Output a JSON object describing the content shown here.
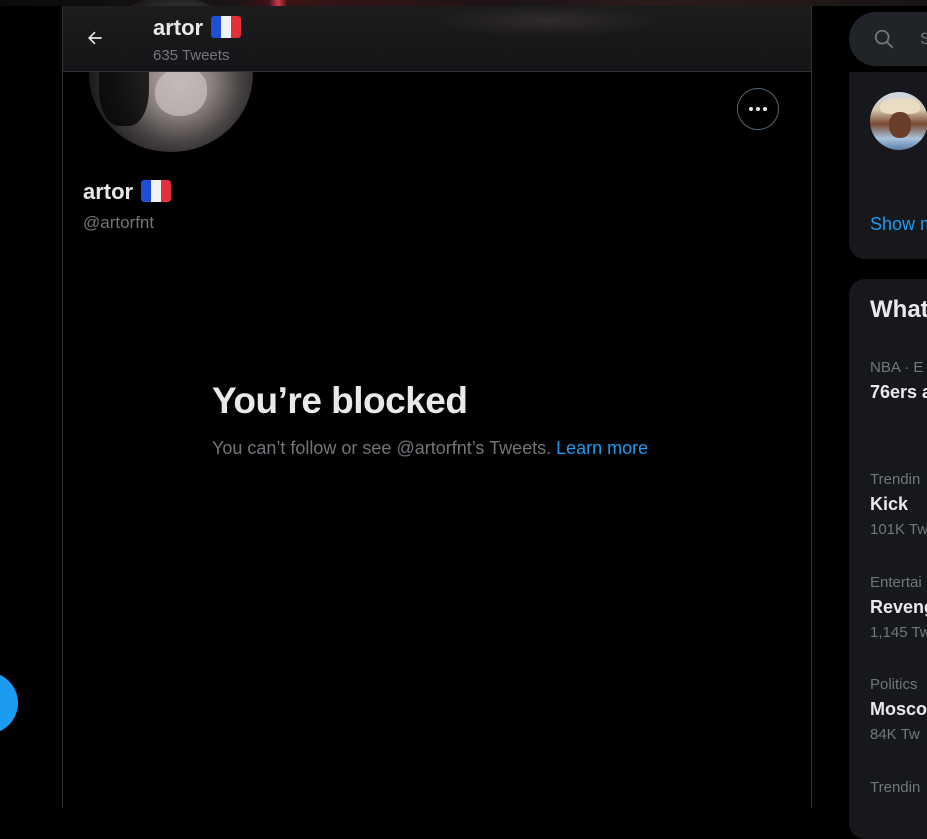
{
  "header": {
    "name": "artor",
    "tweet_count": "635 Tweets"
  },
  "profile": {
    "display_name": "artor",
    "handle": "@artorfnt"
  },
  "blocked": {
    "title": "You’re blocked",
    "message": "You can’t follow or see @artorfnt’s Tweets.",
    "link_text": "Learn more"
  },
  "sidebar": {
    "search_placeholder": "S",
    "show_more": "Show m",
    "trends_title": "What",
    "trends": [
      {
        "context": "NBA · E",
        "name": "76ers a",
        "count": ""
      },
      {
        "context": "Trendin",
        "name": "Kick",
        "count": "101K Tw"
      },
      {
        "context": "Entertai",
        "name": "Reveng",
        "count": "1,145 Tw"
      },
      {
        "context": "Politics",
        "name": "Mosco",
        "count": "84K Tw"
      },
      {
        "context": "Trendin",
        "name": "",
        "count": ""
      }
    ]
  },
  "colors": {
    "accent": "#1d9bf0",
    "background": "#000000",
    "text_primary": "#e7e9ea",
    "text_secondary": "#71767b",
    "card": "#16181c",
    "border": "#2f3336"
  },
  "icons": {
    "back": "arrow-left-icon",
    "more": "ellipsis-icon",
    "search": "search-icon",
    "flag": "france-flag-icon"
  }
}
